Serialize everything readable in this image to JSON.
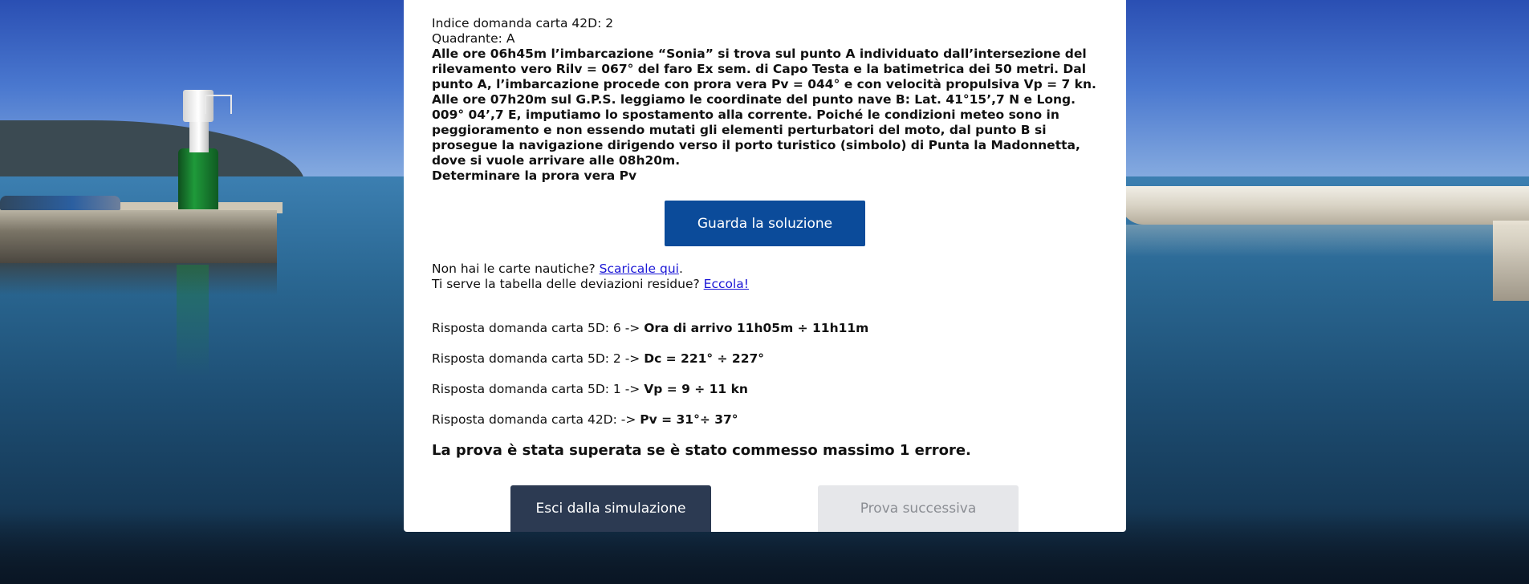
{
  "header": {
    "index_label": "Indice domanda carta 42D: 2",
    "quadrant_label": "Quadrante: A"
  },
  "problem": {
    "paragraph_1": "Alle ore 06h45m l’imbarcazione “Sonia” si trova sul punto A individuato dall’intersezione del rilevamento vero Rilv = 067° del faro Ex sem. di Capo Testa e la batimetrica dei 50 metri. Dal punto A, l’imbarcazione procede con prora vera Pv = 044° e con velocità propulsiva Vp = 7 kn.",
    "paragraph_2": "Alle ore 07h20m sul G.P.S. leggiamo le coordinate del punto nave B: Lat. 41°15’,7 N e Long. 009° 04’,7 E, imputiamo lo spostamento alla corrente. Poiché le condizioni meteo sono in peggioramento e non essendo mutati gli elementi perturbatori del moto, dal punto B si prosegue la navigazione dirigendo verso il porto turistico (simbolo) di Punta la Madonnetta, dove si vuole arrivare alle 08h20m.",
    "paragraph_3": "Determinare la prora vera Pv"
  },
  "solution_button": {
    "label": "Guarda la soluzione"
  },
  "links": {
    "charts_text": "Non hai le carte nautiche? ",
    "charts_link": "Scaricale qui",
    "charts_suffix": ".",
    "table_text": "Ti serve la tabella delle deviazioni residue? ",
    "table_link": "Eccola!"
  },
  "answers": [
    {
      "prefix": "Risposta domanda carta 5D: 6 -> ",
      "value": "Ora di arrivo 11h05m ÷ 11h11m"
    },
    {
      "prefix": "Risposta domanda carta 5D: 2 -> ",
      "value": "Dc = 221° ÷ 227°"
    },
    {
      "prefix": "Risposta domanda carta 5D: 1 -> ",
      "value": "Vp = 9 ÷ 11 kn"
    },
    {
      "prefix": "Risposta domanda carta 42D: -> ",
      "value": "Pv = 31°÷ 37°"
    }
  ],
  "verdict": "La prova è stata superata se è stato commesso massimo 1 errore.",
  "footer": {
    "exit_label": "Esci dalla simulazione",
    "next_label": "Prova successiva"
  }
}
